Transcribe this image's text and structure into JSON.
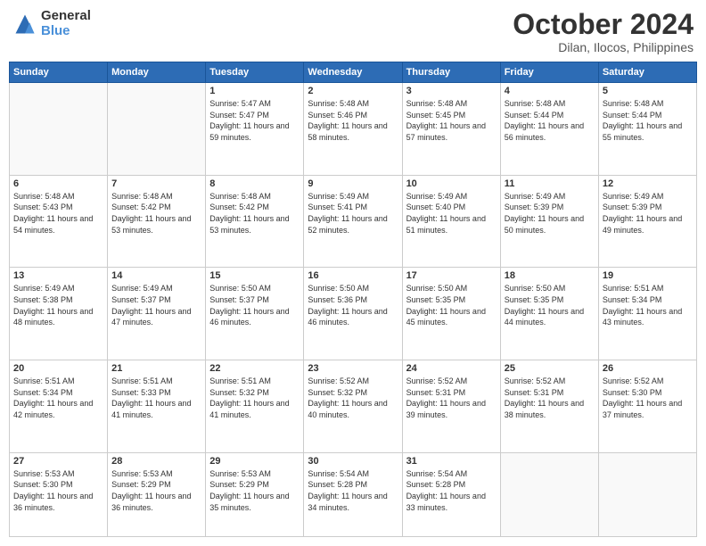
{
  "header": {
    "logo_general": "General",
    "logo_blue": "Blue",
    "month_title": "October 2024",
    "location": "Dilan, Ilocos, Philippines"
  },
  "weekdays": [
    "Sunday",
    "Monday",
    "Tuesday",
    "Wednesday",
    "Thursday",
    "Friday",
    "Saturday"
  ],
  "weeks": [
    [
      {
        "day": "",
        "info": ""
      },
      {
        "day": "",
        "info": ""
      },
      {
        "day": "1",
        "info": "Sunrise: 5:47 AM\nSunset: 5:47 PM\nDaylight: 11 hours and 59 minutes."
      },
      {
        "day": "2",
        "info": "Sunrise: 5:48 AM\nSunset: 5:46 PM\nDaylight: 11 hours and 58 minutes."
      },
      {
        "day": "3",
        "info": "Sunrise: 5:48 AM\nSunset: 5:45 PM\nDaylight: 11 hours and 57 minutes."
      },
      {
        "day": "4",
        "info": "Sunrise: 5:48 AM\nSunset: 5:44 PM\nDaylight: 11 hours and 56 minutes."
      },
      {
        "day": "5",
        "info": "Sunrise: 5:48 AM\nSunset: 5:44 PM\nDaylight: 11 hours and 55 minutes."
      }
    ],
    [
      {
        "day": "6",
        "info": "Sunrise: 5:48 AM\nSunset: 5:43 PM\nDaylight: 11 hours and 54 minutes."
      },
      {
        "day": "7",
        "info": "Sunrise: 5:48 AM\nSunset: 5:42 PM\nDaylight: 11 hours and 53 minutes."
      },
      {
        "day": "8",
        "info": "Sunrise: 5:48 AM\nSunset: 5:42 PM\nDaylight: 11 hours and 53 minutes."
      },
      {
        "day": "9",
        "info": "Sunrise: 5:49 AM\nSunset: 5:41 PM\nDaylight: 11 hours and 52 minutes."
      },
      {
        "day": "10",
        "info": "Sunrise: 5:49 AM\nSunset: 5:40 PM\nDaylight: 11 hours and 51 minutes."
      },
      {
        "day": "11",
        "info": "Sunrise: 5:49 AM\nSunset: 5:39 PM\nDaylight: 11 hours and 50 minutes."
      },
      {
        "day": "12",
        "info": "Sunrise: 5:49 AM\nSunset: 5:39 PM\nDaylight: 11 hours and 49 minutes."
      }
    ],
    [
      {
        "day": "13",
        "info": "Sunrise: 5:49 AM\nSunset: 5:38 PM\nDaylight: 11 hours and 48 minutes."
      },
      {
        "day": "14",
        "info": "Sunrise: 5:49 AM\nSunset: 5:37 PM\nDaylight: 11 hours and 47 minutes."
      },
      {
        "day": "15",
        "info": "Sunrise: 5:50 AM\nSunset: 5:37 PM\nDaylight: 11 hours and 46 minutes."
      },
      {
        "day": "16",
        "info": "Sunrise: 5:50 AM\nSunset: 5:36 PM\nDaylight: 11 hours and 46 minutes."
      },
      {
        "day": "17",
        "info": "Sunrise: 5:50 AM\nSunset: 5:35 PM\nDaylight: 11 hours and 45 minutes."
      },
      {
        "day": "18",
        "info": "Sunrise: 5:50 AM\nSunset: 5:35 PM\nDaylight: 11 hours and 44 minutes."
      },
      {
        "day": "19",
        "info": "Sunrise: 5:51 AM\nSunset: 5:34 PM\nDaylight: 11 hours and 43 minutes."
      }
    ],
    [
      {
        "day": "20",
        "info": "Sunrise: 5:51 AM\nSunset: 5:34 PM\nDaylight: 11 hours and 42 minutes."
      },
      {
        "day": "21",
        "info": "Sunrise: 5:51 AM\nSunset: 5:33 PM\nDaylight: 11 hours and 41 minutes."
      },
      {
        "day": "22",
        "info": "Sunrise: 5:51 AM\nSunset: 5:32 PM\nDaylight: 11 hours and 41 minutes."
      },
      {
        "day": "23",
        "info": "Sunrise: 5:52 AM\nSunset: 5:32 PM\nDaylight: 11 hours and 40 minutes."
      },
      {
        "day": "24",
        "info": "Sunrise: 5:52 AM\nSunset: 5:31 PM\nDaylight: 11 hours and 39 minutes."
      },
      {
        "day": "25",
        "info": "Sunrise: 5:52 AM\nSunset: 5:31 PM\nDaylight: 11 hours and 38 minutes."
      },
      {
        "day": "26",
        "info": "Sunrise: 5:52 AM\nSunset: 5:30 PM\nDaylight: 11 hours and 37 minutes."
      }
    ],
    [
      {
        "day": "27",
        "info": "Sunrise: 5:53 AM\nSunset: 5:30 PM\nDaylight: 11 hours and 36 minutes."
      },
      {
        "day": "28",
        "info": "Sunrise: 5:53 AM\nSunset: 5:29 PM\nDaylight: 11 hours and 36 minutes."
      },
      {
        "day": "29",
        "info": "Sunrise: 5:53 AM\nSunset: 5:29 PM\nDaylight: 11 hours and 35 minutes."
      },
      {
        "day": "30",
        "info": "Sunrise: 5:54 AM\nSunset: 5:28 PM\nDaylight: 11 hours and 34 minutes."
      },
      {
        "day": "31",
        "info": "Sunrise: 5:54 AM\nSunset: 5:28 PM\nDaylight: 11 hours and 33 minutes."
      },
      {
        "day": "",
        "info": ""
      },
      {
        "day": "",
        "info": ""
      }
    ]
  ]
}
